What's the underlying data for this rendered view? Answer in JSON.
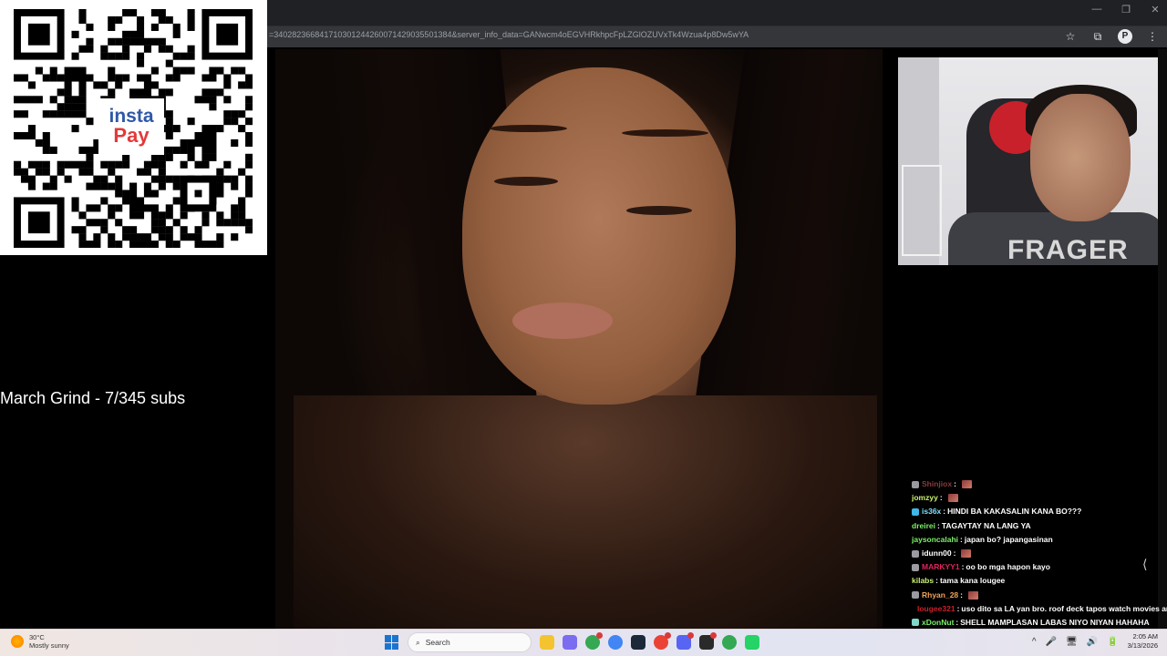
{
  "browser": {
    "url": "=340282366841710301244260071429035501384&server_info_data=GANwcm4oEGVHRkhpcFpLZGlOZUVxTk4Wzua4p8Dw5wYA",
    "window_controls": [
      "—",
      "❐",
      "✕"
    ],
    "icons": [
      "star-icon",
      "extensions-icon",
      "profile-icon",
      "menu-icon"
    ],
    "profile_initial": "P",
    "star_glyph": "☆",
    "ext_glyph": "⧉",
    "menu_glyph": "⋮"
  },
  "qr": {
    "brand_top": "insta",
    "brand_bottom": "Pay",
    "colors": {
      "insta": "#2f58a8",
      "pay": "#e23a3a"
    }
  },
  "overlay": {
    "grind_text": "March Grind - 7/345 subs"
  },
  "webcam": {
    "shirt_text": "FRAGER"
  },
  "chat": {
    "messages": [
      {
        "user": "Shinjiox",
        "user_color": "#8b3a3a",
        "badges": [
          "sword"
        ],
        "text": "",
        "emote": true
      },
      {
        "user": "jomzyy",
        "user_color": "#c9f06f",
        "badges": [],
        "text": "",
        "emote": true
      },
      {
        "user": "is36x",
        "user_color": "#7be3ff",
        "badges": [
          "prime"
        ],
        "text": "HINDI BA KAKASALIN KANA BO???",
        "emote": false
      },
      {
        "user": "dreirei",
        "user_color": "#7cf06a",
        "badges": [],
        "text": "TAGAYTAY NA LANG YA",
        "emote": false
      },
      {
        "user": "jaysoncalahi",
        "user_color": "#7cf06a",
        "badges": [],
        "text": "japan bo? japangasinan",
        "emote": false
      },
      {
        "user": "idunn00",
        "user_color": "#ffffff",
        "badges": [
          "sword"
        ],
        "text": "",
        "emote": true
      },
      {
        "user": "MARKYY1",
        "user_color": "#e0245e",
        "badges": [
          "sword"
        ],
        "text": "oo bo mga hapon kayo",
        "emote": false
      },
      {
        "user": "kilabs",
        "user_color": "#c9f06f",
        "badges": [],
        "text": "tama kana lougee",
        "emote": false
      },
      {
        "user": "Rhyan_28",
        "user_color": "#f0a35a",
        "badges": [
          "sword"
        ],
        "text": "",
        "emote": true
      },
      {
        "user": "lougee321",
        "user_color": "#c8212b",
        "badges": [
          "prime",
          "sub"
        ],
        "text": "uso dito sa LA yan bro. roof deck tapos watch movies and",
        "emote": false
      },
      {
        "user": "xDonNut",
        "user_color": "#7cf06a",
        "badges": [
          "sub"
        ],
        "text": "SHELL MAMPLASAN LABAS NIYO NIYAN HAHAHA",
        "emote": false
      }
    ],
    "scroll_arrow": "⟨"
  },
  "taskbar": {
    "weather_temp": "30°C",
    "weather_desc": "Mostly sunny",
    "search_placeholder": "Search",
    "search_glyph": "⌕",
    "apps": [
      {
        "name": "file-explorer-icon",
        "color": "#f4c430",
        "badge": false
      },
      {
        "name": "copilot-icon",
        "color": "#7b6cf0",
        "badge": false
      },
      {
        "name": "chrome-icon",
        "color": "#34a853",
        "badge": true
      },
      {
        "name": "chrome-alt-icon",
        "color": "#4285f4",
        "badge": false
      },
      {
        "name": "steam-icon",
        "color": "#1b2838",
        "badge": false
      },
      {
        "name": "chrome-profile-icon",
        "color": "#ea4335",
        "badge": true
      },
      {
        "name": "discord-icon",
        "color": "#5865f2",
        "badge": true
      },
      {
        "name": "obs-icon",
        "color": "#2a2a2a",
        "badge": true
      },
      {
        "name": "chrome-dev-icon",
        "color": "#34a853",
        "badge": false
      },
      {
        "name": "tiktok-studio-icon",
        "color": "#25d366",
        "badge": false
      }
    ],
    "tray_icons": [
      "^",
      "🎤",
      "🖥",
      "🔊",
      "🔋"
    ],
    "time": "2:05 AM",
    "date": "3/13/2026"
  }
}
